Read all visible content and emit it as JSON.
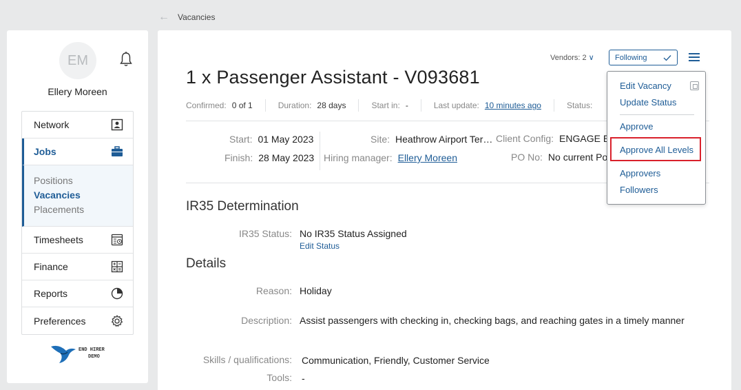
{
  "breadcrumb": {
    "back_icon": "arrow-left-icon",
    "label": "Vacancies"
  },
  "user": {
    "initials": "EM",
    "name": "Ellery Moreen"
  },
  "nav": {
    "items": [
      {
        "label": "Network",
        "icon": "contact-card-icon"
      },
      {
        "label": "Jobs",
        "icon": "briefcase-icon",
        "active": true
      },
      {
        "label": "Timesheets",
        "icon": "timesheet-icon"
      },
      {
        "label": "Finance",
        "icon": "calculator-icon"
      },
      {
        "label": "Reports",
        "icon": "pie-chart-icon"
      },
      {
        "label": "Preferences",
        "icon": "gear-icon"
      }
    ],
    "jobs_sub": [
      "Positions",
      "Vacancies",
      "Placements"
    ]
  },
  "logo": {
    "line1": "END HIRER",
    "line2": "DEMO"
  },
  "header": {
    "vendors_label": "Vendors: 2",
    "following_label": "Following"
  },
  "vacancy": {
    "title": "1 x Passenger Assistant - V093681",
    "confirmed_label": "Confirmed:",
    "confirmed_value": "0 of 1",
    "duration_label": "Duration:",
    "duration_value": "28 days",
    "startin_label": "Start in:",
    "startin_value": "-",
    "lastupdate_label": "Last update:",
    "lastupdate_value": "10 minutes ago",
    "status_label": "Status:",
    "start_label": "Start:",
    "start_value": "01 May 2023",
    "finish_label": "Finish:",
    "finish_value": "28 May 2023",
    "site_label": "Site:",
    "site_value": "Heathrow Airport Ter…",
    "hiring_label": "Hiring manager:",
    "hiring_value": "Ellery Moreen",
    "client_label": "Client Config:",
    "client_value": "ENGAGE E",
    "po_label": "PO No:",
    "po_value": "No current Po"
  },
  "ir35": {
    "heading": "IR35 Determination",
    "status_label": "IR35 Status:",
    "status_value": "No IR35 Status Assigned",
    "edit_label": "Edit Status"
  },
  "details": {
    "heading": "Details",
    "reason_label": "Reason:",
    "reason_value": "Holiday",
    "desc_label": "Description:",
    "desc_value": "Assist passengers with checking in, checking bags, and reaching gates in a timely manner",
    "skills_label": "Skills / qualifications:",
    "skills_value": "Communication, Friendly, Customer Service",
    "tools_label": "Tools:",
    "tools_value": "-"
  },
  "menu": {
    "items": [
      "Edit Vacancy",
      "Update Status",
      "Approve",
      "Approve All Levels",
      "Approvers",
      "Followers"
    ],
    "highlighted": "Approve All Levels",
    "highlight_color": "#d9202a"
  },
  "colors": {
    "accent": "#1e5c96"
  }
}
